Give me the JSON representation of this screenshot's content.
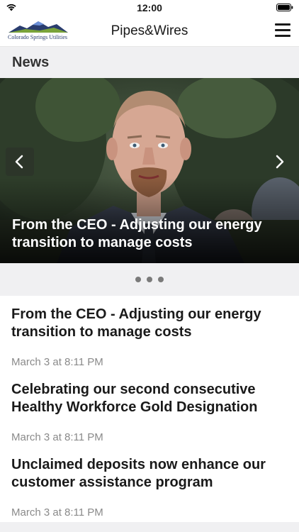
{
  "status_bar": {
    "time": "12:00"
  },
  "nav": {
    "logo_text": "Colorado Springs Utilities",
    "title": "Pipes&Wires"
  },
  "section": {
    "title": "News"
  },
  "carousel": {
    "caption": "From the CEO - Adjusting our energy transition to manage costs",
    "page_count": 3,
    "active_index": 0
  },
  "news": [
    {
      "headline": "From the CEO - Adjusting our energy transition to manage costs",
      "date": "March 3 at 8:11 PM"
    },
    {
      "headline": "Celebrating our second consecutive Healthy Workforce Gold Designation",
      "date": "March 3 at 8:11 PM"
    },
    {
      "headline": "Unclaimed deposits now enhance our customer assistance program",
      "date": "March 3 at 8:11 PM"
    }
  ],
  "colors": {
    "section_bg": "#f0f0f2",
    "date_gray": "#8a8a8a",
    "logo_blue": "#2a3d6e",
    "logo_green": "#7aa33a"
  }
}
